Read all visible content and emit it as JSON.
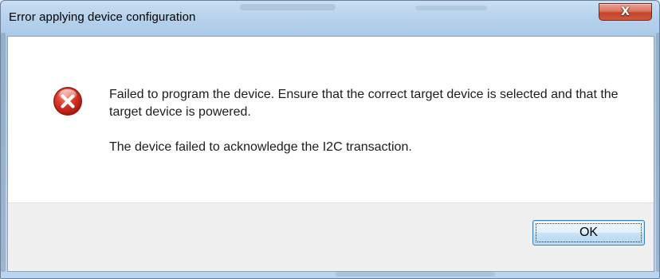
{
  "window": {
    "title": "Error applying device configuration",
    "close_glyph": "X"
  },
  "dialog": {
    "icon": "error-icon",
    "message": "Failed to program the device. Ensure that the correct target device is selected and that the target device is powered.",
    "detail": "The device failed to acknowledge the I2C transaction."
  },
  "buttons": {
    "ok_label": "OK"
  },
  "colors": {
    "error_red": "#d5261b",
    "button_border": "#3c7fb1",
    "footer_bg": "#f0f0f0"
  }
}
